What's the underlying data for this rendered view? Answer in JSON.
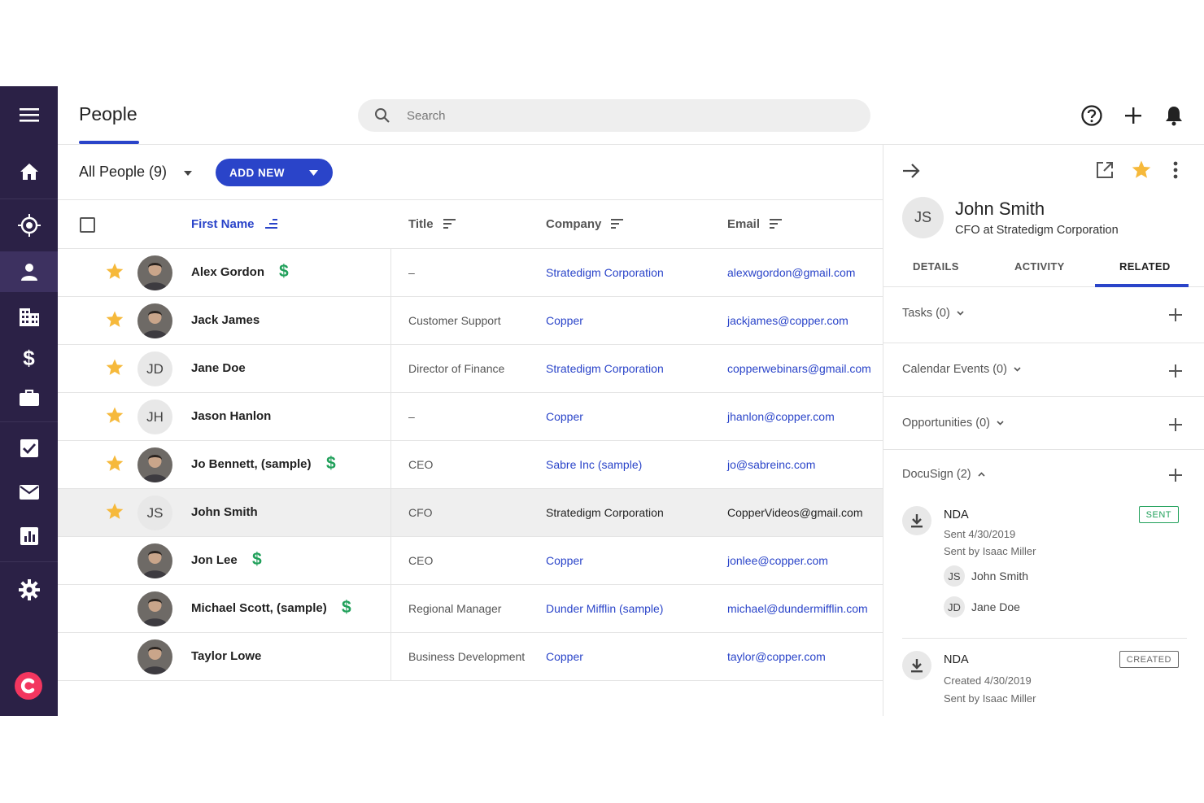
{
  "header": {
    "title": "People",
    "search_placeholder": "Search"
  },
  "sidebar": {
    "items": [
      {
        "icon": "menu-icon"
      },
      {
        "icon": "home-icon"
      },
      {
        "icon": "target-icon"
      },
      {
        "icon": "person-icon",
        "active": true
      },
      {
        "icon": "building-icon"
      },
      {
        "icon": "dollar-icon"
      },
      {
        "icon": "briefcase-icon"
      },
      {
        "icon": "checkbox-icon"
      },
      {
        "icon": "mail-icon"
      },
      {
        "icon": "chart-icon"
      },
      {
        "icon": "gear-icon"
      }
    ]
  },
  "list": {
    "view_label": "All People (9)",
    "add_new_label": "ADD NEW",
    "columns": {
      "first_name": "First Name",
      "title": "Title",
      "company": "Company",
      "email": "Email"
    },
    "rows": [
      {
        "starred": true,
        "avatar": "photo",
        "initials": "",
        "name": "Alex Gordon",
        "opportunity": true,
        "title": "–",
        "company": "Stratedigm Corporation",
        "email": "alexwgordon@gmail.com"
      },
      {
        "starred": true,
        "avatar": "photo",
        "initials": "",
        "name": "Jack James",
        "opportunity": false,
        "title": "Customer Support",
        "company": "Copper",
        "email": "jackjames@copper.com"
      },
      {
        "starred": true,
        "avatar": "initials",
        "initials": "JD",
        "name": "Jane Doe",
        "opportunity": false,
        "title": "Director of Finance",
        "company": "Stratedigm Corporation",
        "email": "copperwebinars@gmail.com"
      },
      {
        "starred": true,
        "avatar": "initials",
        "initials": "JH",
        "name": "Jason Hanlon",
        "opportunity": false,
        "title": "–",
        "company": "Copper",
        "email": "jhanlon@copper.com"
      },
      {
        "starred": true,
        "avatar": "photo",
        "initials": "",
        "name": "Jo Bennett, (sample)",
        "opportunity": true,
        "title": "CEO",
        "company": "Sabre Inc (sample)",
        "email": "jo@sabreinc.com"
      },
      {
        "starred": true,
        "avatar": "initials",
        "initials": "JS",
        "name": "John Smith",
        "opportunity": false,
        "title": "CFO",
        "company": "Stratedigm Corporation",
        "email": "CopperVideos@gmail.com",
        "selected": true
      },
      {
        "starred": false,
        "avatar": "photo",
        "initials": "",
        "name": "Jon Lee",
        "opportunity": true,
        "title": "CEO",
        "company": "Copper",
        "email": "jonlee@copper.com"
      },
      {
        "starred": false,
        "avatar": "photo",
        "initials": "",
        "name": "Michael Scott, (sample)",
        "opportunity": true,
        "title": "Regional Manager",
        "company": "Dunder Mifflin (sample)",
        "email": "michael@dundermifflin.com"
      },
      {
        "starred": false,
        "avatar": "photo",
        "initials": "",
        "name": "Taylor Lowe",
        "opportunity": false,
        "title": "Business Development",
        "company": "Copper",
        "email": "taylor@copper.com"
      }
    ]
  },
  "detail": {
    "initials": "JS",
    "name": "John Smith",
    "subtitle": "CFO at Stratedigm Corporation",
    "tabs": [
      "DETAILS",
      "ACTIVITY",
      "RELATED"
    ],
    "active_tab": "RELATED",
    "sections": {
      "tasks": "Tasks (0)",
      "calendar": "Calendar Events (0)",
      "opportunities": "Opportunities (0)",
      "docusign": "DocuSign (2)"
    },
    "docs": [
      {
        "title": "NDA",
        "badge": "SENT",
        "line1": "Sent 4/30/2019",
        "line2": "Sent by Isaac Miller",
        "signers": [
          {
            "initials": "JS",
            "name": "John Smith"
          },
          {
            "initials": "JD",
            "name": "Jane Doe"
          }
        ]
      },
      {
        "title": "NDA",
        "badge": "CREATED",
        "line1": "Created 4/30/2019",
        "line2": "Sent by Isaac Miller"
      }
    ]
  },
  "colors": {
    "sidebar": "#2b2146",
    "accent": "#2a44c9",
    "star": "#f6b93b",
    "money": "#20a05a",
    "logo": "#f3365f"
  }
}
